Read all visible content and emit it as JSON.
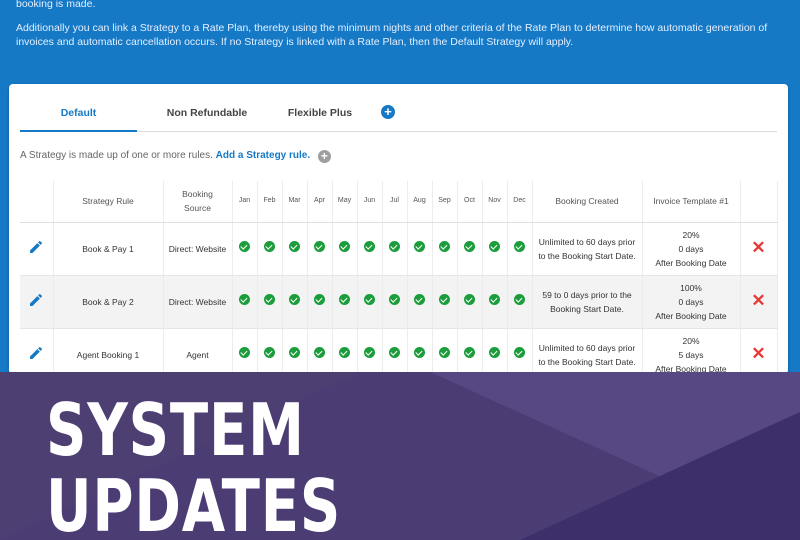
{
  "header": {
    "line1": "booking is made.",
    "paragraph": "Additionally you can link a Strategy to a Rate Plan, thereby using the minimum nights and other criteria of the Rate Plan to determine how automatic generation of invoices and automatic cancellation occurs. If no Strategy is linked with a Rate Plan, then the Default Strategy will apply."
  },
  "tabs": [
    {
      "label": "Default",
      "active": true
    },
    {
      "label": "Non Refundable",
      "active": false
    },
    {
      "label": "Flexible Plus",
      "active": false
    }
  ],
  "intro": {
    "text": "A Strategy is made up of one or more rules.",
    "link": "Add a Strategy rule."
  },
  "table": {
    "headers": {
      "strategy_rule": "Strategy Rule",
      "booking_source_1": "Booking",
      "booking_source_2": "Source",
      "booking_created": "Booking Created",
      "invoice_template": "Invoice Template #1"
    },
    "months": [
      "Jan",
      "Feb",
      "Mar",
      "Apr",
      "May",
      "Jun",
      "Jul",
      "Aug",
      "Sep",
      "Oct",
      "Nov",
      "Dec"
    ],
    "rows": [
      {
        "rule": "Book & Pay 1",
        "source": "Direct: Website",
        "created_1": "Unlimited to 60 days prior",
        "created_2": "to the Booking Start Date.",
        "inv_1": "20%",
        "inv_2": "0 days",
        "inv_3": "After Booking Date"
      },
      {
        "rule": "Book & Pay 2",
        "source": "Direct: Website",
        "created_1": "59 to 0 days prior to the",
        "created_2": "Booking Start Date.",
        "inv_1": "100%",
        "inv_2": "0 days",
        "inv_3": "After Booking Date"
      },
      {
        "rule": "Agent Booking 1",
        "source": "Agent",
        "created_1": "Unlimited to 60 days prior",
        "created_2": "to the Booking Start Date.",
        "inv_1": "20%",
        "inv_2": "5 days",
        "inv_3": "After Booking Date"
      }
    ]
  },
  "banner": {
    "line1": "SYSTEM",
    "line2": "UPDATES"
  },
  "icons": {
    "edit": "pencil-icon",
    "check": "check-circle-icon",
    "delete": "close-icon",
    "add": "plus-circle-icon"
  },
  "colors": {
    "primary": "#1679c6",
    "check_green": "#1a9d3a",
    "delete_red": "#e53935",
    "banner_bg": "#4b3c74"
  }
}
